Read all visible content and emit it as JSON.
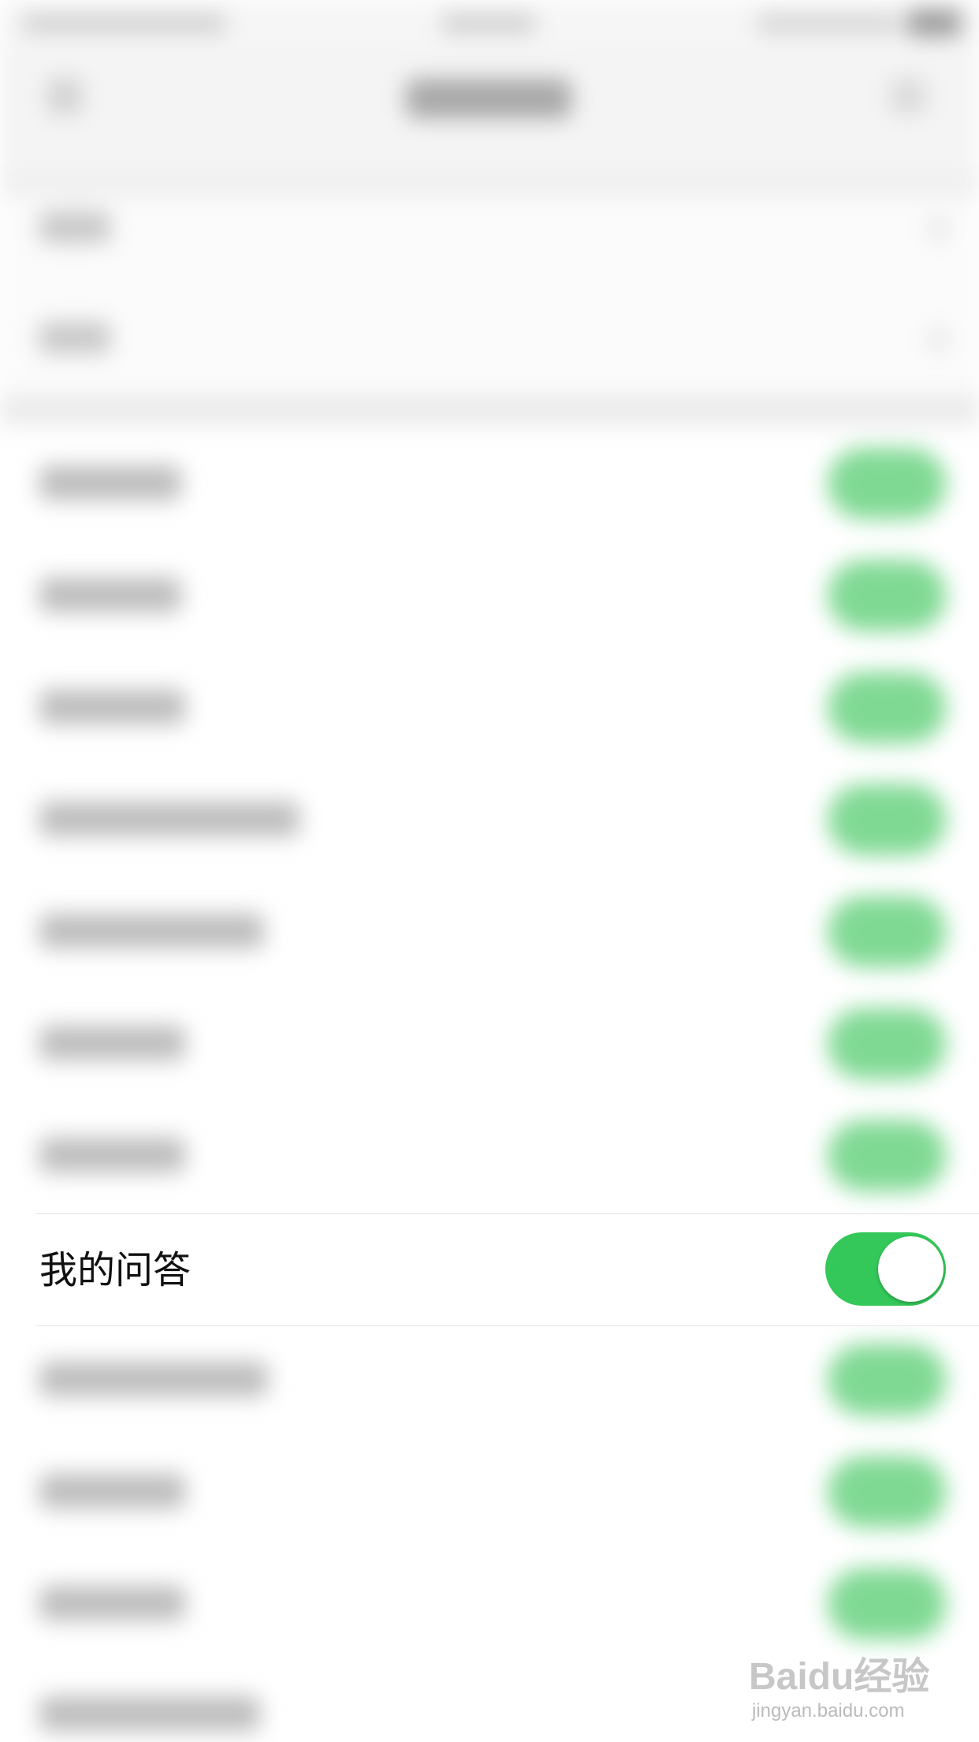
{
  "setting_row": {
    "label": "我的问答",
    "toggle_on": true
  },
  "watermark": {
    "logo_text": "Baidu经验",
    "url_text": "jingyan.baidu.com"
  },
  "colors": {
    "toggle_on": "#34c759",
    "toggle_knob": "#ffffff",
    "label_text": "#111111"
  },
  "icons": {
    "back": "back-icon",
    "chevron": "chevron-right-icon"
  }
}
